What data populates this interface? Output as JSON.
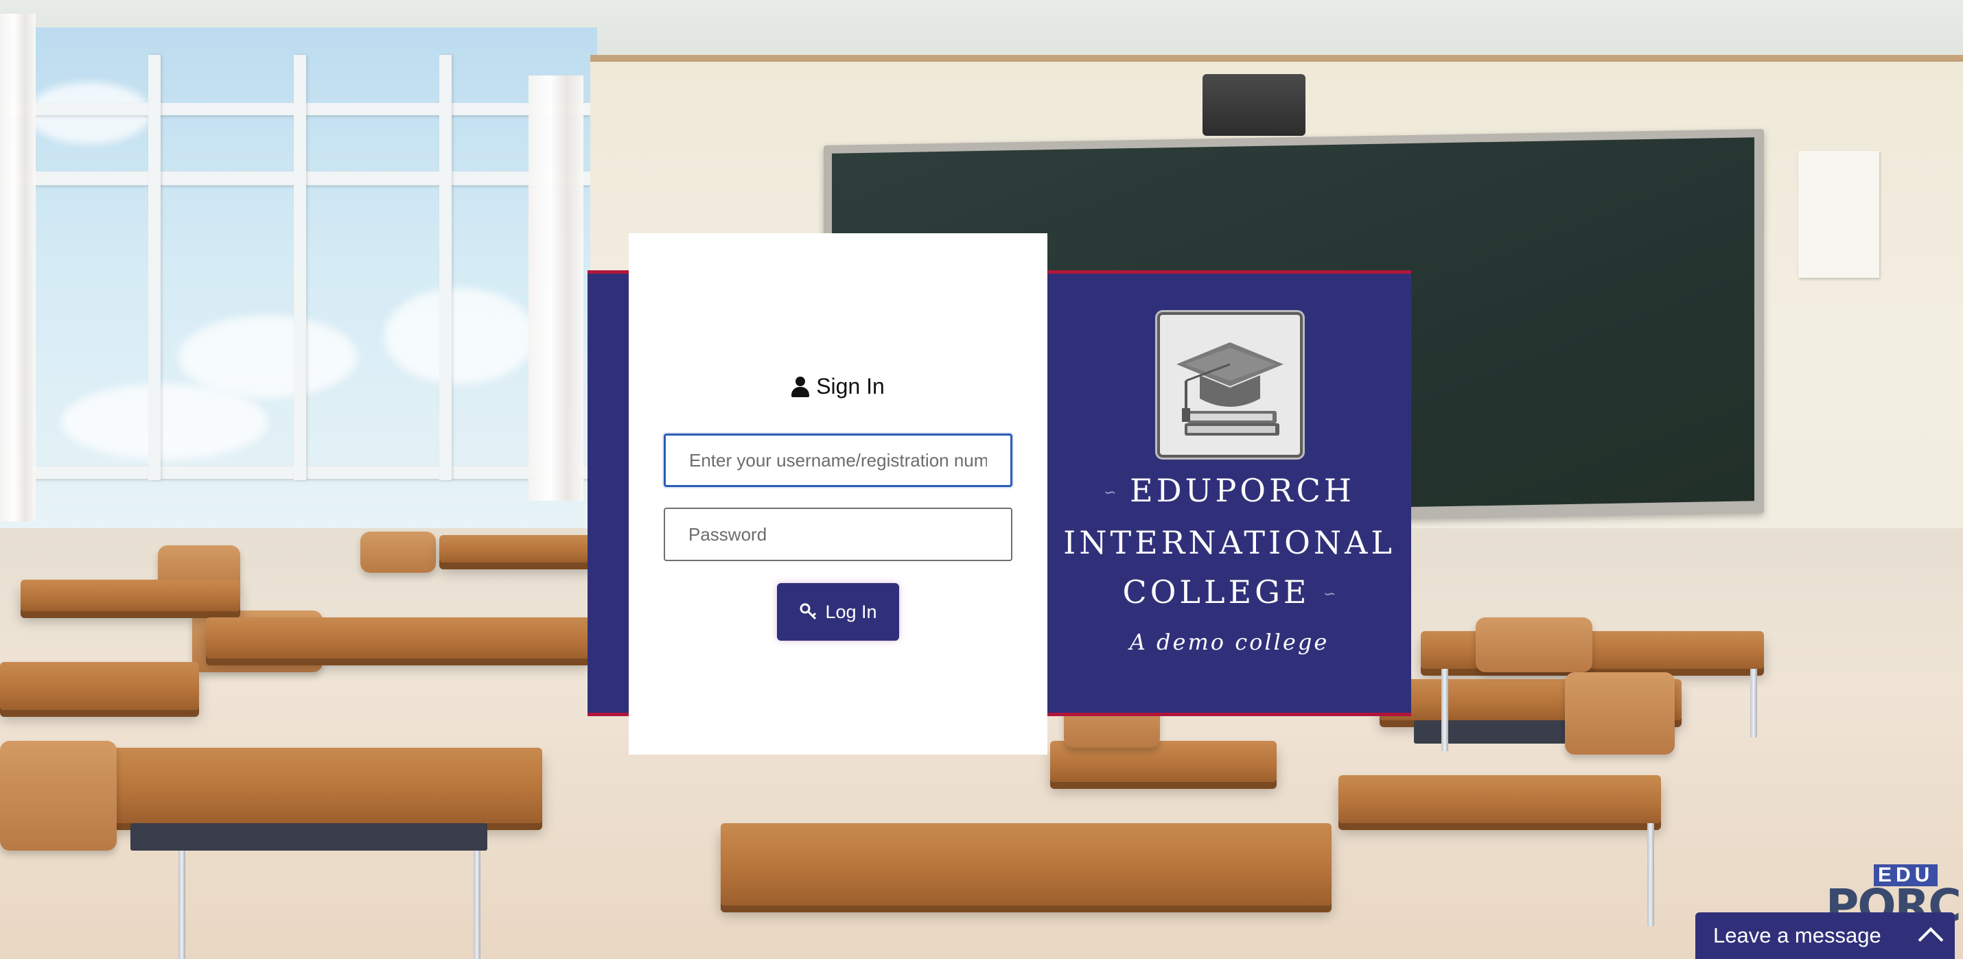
{
  "signin": {
    "title": "Sign In",
    "username_placeholder": "Enter your username/registration num",
    "password_placeholder": "Password",
    "login_label": "Log In"
  },
  "college": {
    "name_line1": "EDUPORCH",
    "name_line2": "INTERNATIONAL",
    "name_line3": "COLLEGE",
    "tagline": "A demo college",
    "logo_icon": "graduation-cap-books-icon"
  },
  "brand": {
    "top": "EDU",
    "main": "PORCH"
  },
  "chat": {
    "label": "Leave a message",
    "icon": "chevron-up-icon"
  },
  "colors": {
    "primary": "#30307a",
    "accent_border": "#b0163a",
    "focus": "#2b5db8"
  }
}
